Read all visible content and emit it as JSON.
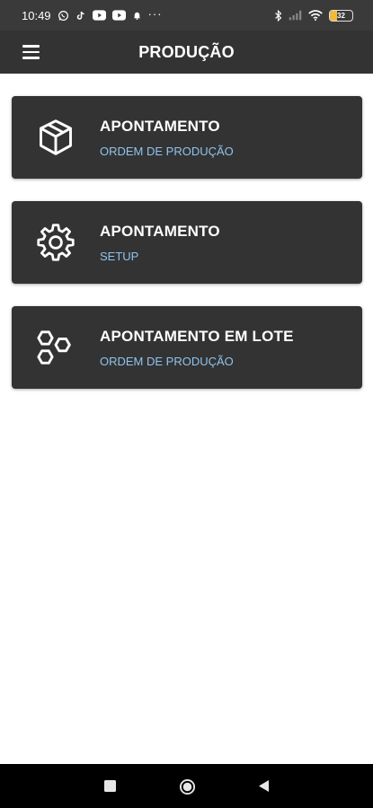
{
  "status_bar": {
    "time": "10:49",
    "left_icons": [
      "whatsapp-icon",
      "tiktok-icon",
      "youtube-icon",
      "youtube-icon",
      "notification-bell-icon"
    ],
    "overflow": "···",
    "right_icons": [
      "bluetooth-icon",
      "cellular-signal-icon",
      "wifi-icon"
    ],
    "battery_level": "32"
  },
  "app_bar": {
    "title": "PRODUÇÃO",
    "menu_icon": "hamburger-menu-icon"
  },
  "cards": [
    {
      "title": "APONTAMENTO",
      "subtitle": "ORDEM DE PRODUÇÃO",
      "icon": "box-icon"
    },
    {
      "title": "APONTAMENTO",
      "subtitle": "SETUP",
      "icon": "gear-icon"
    },
    {
      "title": "APONTAMENTO EM LOTE",
      "subtitle": "ORDEM DE PRODUÇÃO",
      "icon": "hexagons-icon"
    }
  ],
  "nav_bar": {
    "buttons": [
      "recents-square-icon",
      "home-circle-icon",
      "back-triangle-icon"
    ]
  },
  "colors": {
    "status_bar_bg": "#3a3a3a",
    "app_bar_bg": "#333333",
    "card_bg": "#333333",
    "subtitle_accent": "#8fc3ee",
    "nav_bar_bg": "#000000",
    "page_bg": "#ffffff"
  }
}
